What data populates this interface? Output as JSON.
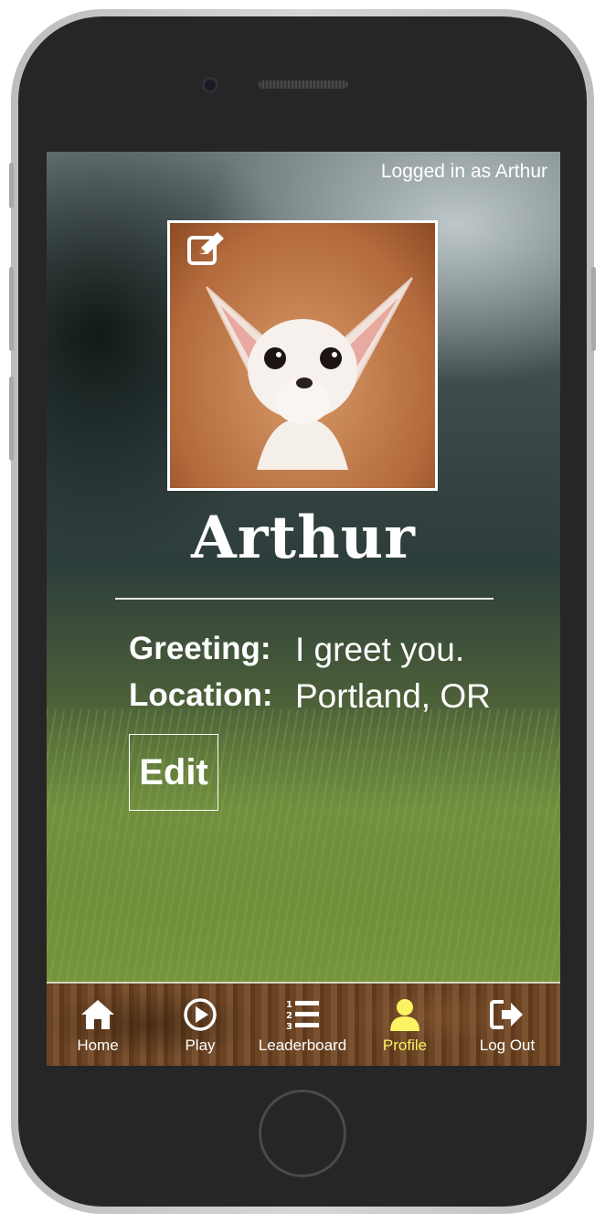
{
  "header": {
    "login_status": "Logged in as Arthur"
  },
  "profile": {
    "name": "Arthur",
    "greeting_label": "Greeting:",
    "greeting_value": "I greet you.",
    "location_label": "Location:",
    "location_value": "Portland, OR",
    "edit_label": "Edit"
  },
  "nav": {
    "items": [
      {
        "label": "Home",
        "icon": "home-icon"
      },
      {
        "label": "Play",
        "icon": "play-icon"
      },
      {
        "label": "Leaderboard",
        "icon": "leaderboard-icon"
      },
      {
        "label": "Profile",
        "icon": "profile-icon",
        "active": true
      },
      {
        "label": "Log Out",
        "icon": "logout-icon"
      }
    ],
    "active_color": "#fbf364"
  }
}
